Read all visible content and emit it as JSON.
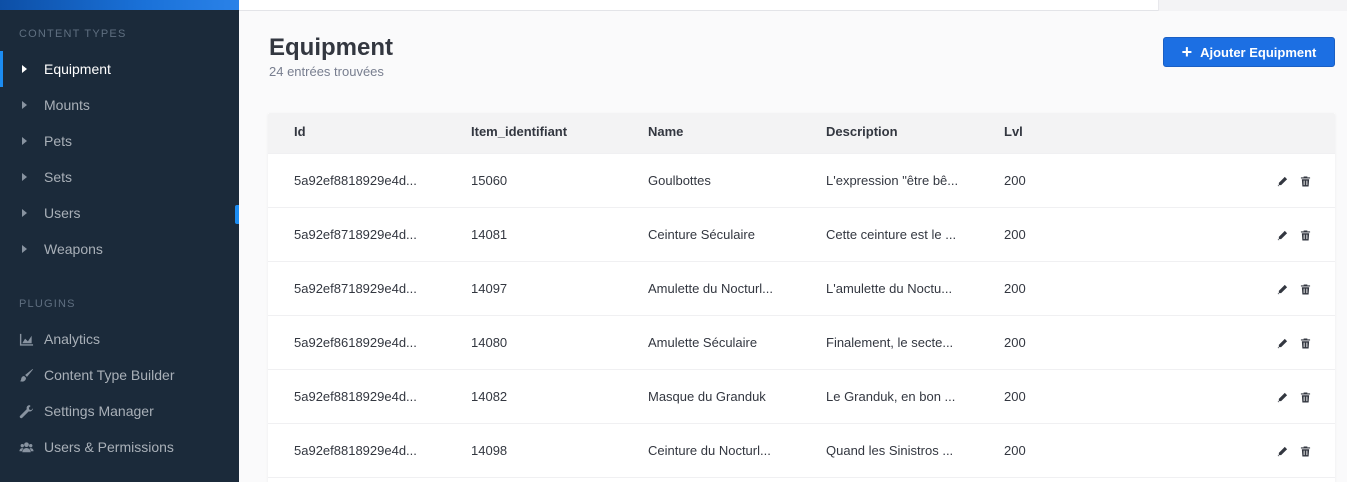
{
  "sidebar": {
    "content_types_title": "CONTENT TYPES",
    "content_types": [
      {
        "label": "Equipment",
        "active": true
      },
      {
        "label": "Mounts"
      },
      {
        "label": "Pets"
      },
      {
        "label": "Sets"
      },
      {
        "label": "Users"
      },
      {
        "label": "Weapons"
      }
    ],
    "plugins_title": "PLUGINS",
    "plugins": [
      {
        "label": "Analytics",
        "icon": "analytics-icon"
      },
      {
        "label": "Content Type Builder",
        "icon": "paint-brush-icon"
      },
      {
        "label": "Settings Manager",
        "icon": "wrench-icon"
      },
      {
        "label": "Users & Permissions",
        "icon": "users-icon"
      }
    ]
  },
  "header": {
    "title": "Equipment",
    "subtitle": "24 entrées trouvées",
    "add_button_label": "Ajouter Equipment"
  },
  "table": {
    "columns": [
      "Id",
      "Item_identifiant",
      "Name",
      "Description",
      "Lvl"
    ],
    "rows": [
      {
        "id": "5a92ef8818929e4d...",
        "item": "15060",
        "name": "Goulbottes",
        "description": "L'expression \"être bê...",
        "lvl": "200"
      },
      {
        "id": "5a92ef8718929e4d...",
        "item": "14081",
        "name": "Ceinture Séculaire",
        "description": "Cette ceinture est le ...",
        "lvl": "200"
      },
      {
        "id": "5a92ef8718929e4d...",
        "item": "14097",
        "name": "Amulette du Nocturl...",
        "description": "L'amulette du Noctu...",
        "lvl": "200"
      },
      {
        "id": "5a92ef8618929e4d...",
        "item": "14080",
        "name": "Amulette Séculaire",
        "description": "Finalement, le secte...",
        "lvl": "200"
      },
      {
        "id": "5a92ef8818929e4d...",
        "item": "14082",
        "name": "Masque du Granduk",
        "description": "Le Granduk, en bon ...",
        "lvl": "200"
      },
      {
        "id": "5a92ef8818929e4d...",
        "item": "14098",
        "name": "Ceinture du Nocturl...",
        "description": "Quand les Sinistros ...",
        "lvl": "200"
      }
    ]
  },
  "colors": {
    "sidebar_bg": "#1b2a3a",
    "accent": "#1c6fe3",
    "active_indicator": "#1c8cf1"
  }
}
